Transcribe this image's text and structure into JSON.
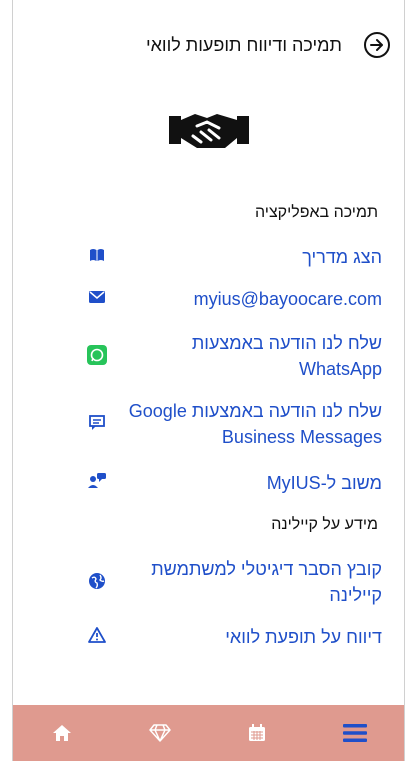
{
  "header": {
    "title": "תמיכה ודיווח תופעות לוואי"
  },
  "sections": {
    "support": "תמיכה באפליקציה",
    "info": "מידע על קיילינה"
  },
  "items": [
    {
      "label": "הצג מדריך",
      "icon": "book-icon"
    },
    {
      "label": "myius@bayoocare.com",
      "icon": "envelope-icon"
    },
    {
      "label": "שלח לנו הודעה באמצעות WhatsApp",
      "icon": "whatsapp-icon"
    },
    {
      "label": "שלח לנו הודעה באמצעות Google Business Messages",
      "icon": "chat-icon"
    },
    {
      "label": "משוב ל-MyIUS",
      "icon": "feedback-icon"
    },
    {
      "label": "קובץ הסבר דיגיטלי למשתמשת קיילינה",
      "icon": "globe-icon"
    },
    {
      "label": "דיווח על תופעת לוואי",
      "icon": "warning-icon"
    }
  ],
  "colors": {
    "link": "#1f4fc9",
    "bottom_bar": "#df9a8f",
    "active_tab": "#1f4fc9"
  },
  "bottom_nav": [
    {
      "icon": "home-icon"
    },
    {
      "icon": "diamond-icon"
    },
    {
      "icon": "calendar-icon"
    },
    {
      "icon": "menu-icon",
      "active": true
    }
  ]
}
